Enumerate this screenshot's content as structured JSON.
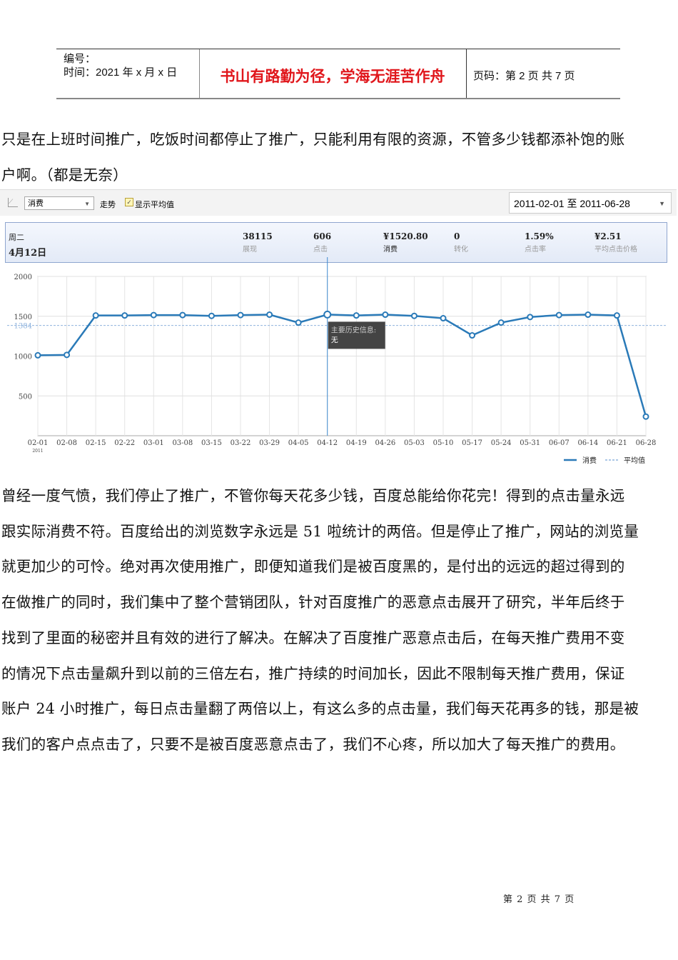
{
  "header": {
    "number_label": "编号：",
    "time_label": "时间：2021 年 x 月 x 日",
    "motto": "书山有路勤为径，学海无涯苦作舟",
    "page_label": "页码：第 2 页  共 7 页"
  },
  "paragraph1": [
    "只是在上班时间推广，吃饭时间都停止了推广，只能利用有限的资源，不管多少钱都添补饱的账",
    "户啊。（都是无奈）"
  ],
  "chart_panel": {
    "metric_select": "消费",
    "trend_label": "走势",
    "show_avg_label": "显示平均值",
    "show_avg_checked": true,
    "date_range": "2011-02-01 至 2011-06-28",
    "day": "周二",
    "date": "4月12日",
    "stats": [
      {
        "value": "38115",
        "label": "展现"
      },
      {
        "value": "606",
        "label": "点击"
      },
      {
        "value": "¥1520.80",
        "label": "消费"
      },
      {
        "value": "0",
        "label": "转化"
      },
      {
        "value": "1.59%",
        "label": "点击率"
      },
      {
        "value": "¥2.51",
        "label": "平均点击价格"
      }
    ],
    "tooltip_title": "主要历史信息:",
    "tooltip_body": "无"
  },
  "chart_data": {
    "type": "line",
    "categories": [
      "02-01",
      "02-08",
      "02-15",
      "02-22",
      "03-01",
      "03-08",
      "03-15",
      "03-22",
      "03-29",
      "04-05",
      "04-12",
      "04-19",
      "04-26",
      "05-03",
      "05-10",
      "05-17",
      "05-24",
      "05-31",
      "06-07",
      "06-14",
      "06-21",
      "06-28"
    ],
    "year_label": "2011",
    "series": [
      {
        "name": "消费",
        "values": [
          1010,
          1015,
          1510,
          1510,
          1515,
          1515,
          1505,
          1515,
          1520,
          1420,
          1521,
          1510,
          1520,
          1505,
          1475,
          1260,
          1420,
          1490,
          1515,
          1520,
          1510,
          240
        ]
      }
    ],
    "average": {
      "name": "平均值",
      "value": 1384,
      "label": "1384"
    },
    "yticks": [
      500,
      1000,
      1500,
      2000
    ],
    "ylim": [
      0,
      2000
    ],
    "highlight_index": 10,
    "grid": true,
    "legend": "bottom-right",
    "colors": {
      "line": "#2a7ab8",
      "avg": "#8fb3dd"
    }
  },
  "paragraph2": [
    "曾经一度气愤，我们停止了推广，不管你每天花多少钱，百度总能给你花完！得到的点击量永远",
    "跟实际消费不符。百度给出的浏览数字永远是 51 啦统计的两倍。但是停止了推广，网站的浏览量",
    "就更加少的可怜。绝对再次使用推广，即便知道我们是被百度黑的，是付出的远远的超过得到的",
    "在做推广的同时，我们集中了整个营销团队，针对百度推广的恶意点击展开了研究，半年后终于",
    "找到了里面的秘密并且有效的进行了解决。在解决了百度推广恶意点击后，在每天推广费用不变",
    "的情况下点击量飙升到以前的三倍左右，推广持续的时间加长，因此不限制每天推广费用，保证",
    "账户 24 小时推广，每日点击量翻了两倍以上，有这么多的点击量，我们每天花再多的钱，那是被",
    "我们的客户点点击了，只要不是被百度恶意点击了，我们不心疼，所以加大了每天推广的费用。"
  ],
  "footer": "第 2 页 共 7 页"
}
